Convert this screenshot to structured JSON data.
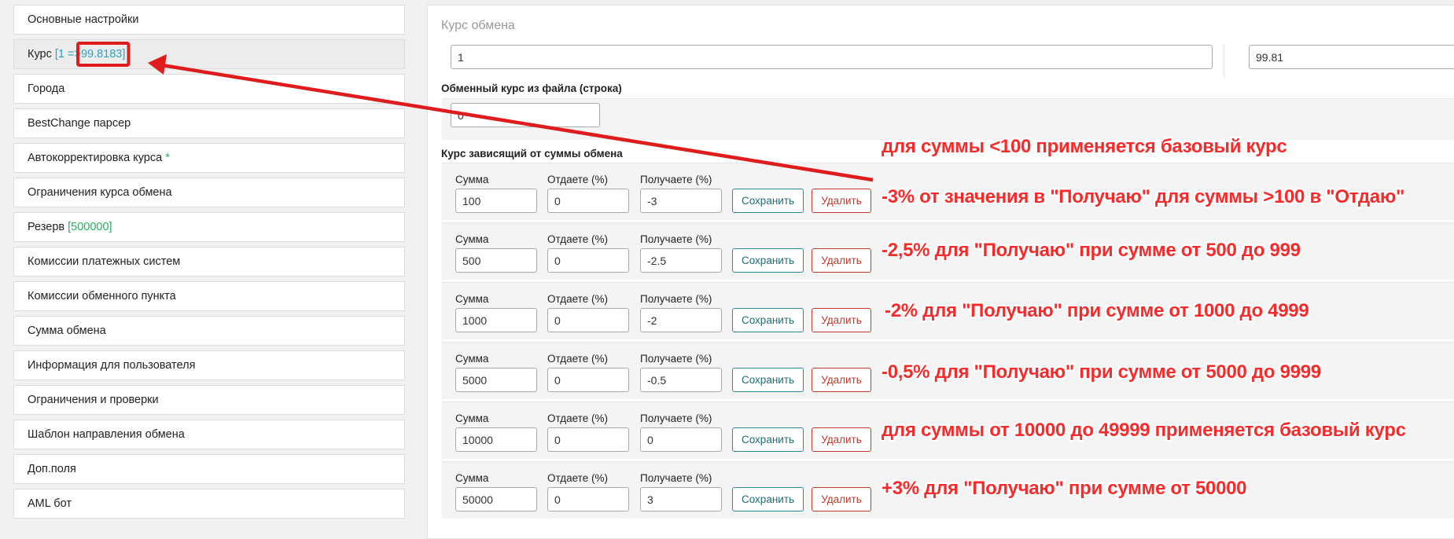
{
  "sidebar": {
    "items": [
      {
        "label": "Основные настройки"
      },
      {
        "label": "Курс",
        "suffix_open": "[1 =>",
        "suffix_value": "99.8183]"
      },
      {
        "label": "Города"
      },
      {
        "label": "BestChange парсер"
      },
      {
        "label": "Автокорректировка курса",
        "star": "*"
      },
      {
        "label": "Ограничения курса обмена"
      },
      {
        "label": "Резерв",
        "suffix": "[500000]"
      },
      {
        "label": "Комиссии платежных систем"
      },
      {
        "label": "Комиссии обменного пункта"
      },
      {
        "label": "Сумма обмена"
      },
      {
        "label": "Информация для пользователя"
      },
      {
        "label": "Ограничения и проверки"
      },
      {
        "label": "Шаблон направления обмена"
      },
      {
        "label": "Доп.поля"
      },
      {
        "label": "AML бот"
      }
    ]
  },
  "main": {
    "title": "Курс обмена",
    "rate_give": "1",
    "rate_get": "99.81",
    "file_rate_label": "Обменный курс из файла (строка)",
    "file_rate_value": "0",
    "dependent_label": "Курс зависящий от суммы обмена",
    "col_sum": "Сумма",
    "col_give": "Отдаете (%)",
    "col_get": "Получаете (%)",
    "save_label": "Сохранить",
    "delete_label": "Удалить",
    "rows": [
      {
        "sum": "100",
        "give": "0",
        "get": "-3"
      },
      {
        "sum": "500",
        "give": "0",
        "get": "-2.5"
      },
      {
        "sum": "1000",
        "give": "0",
        "get": "-2"
      },
      {
        "sum": "5000",
        "give": "0",
        "get": "-0.5"
      },
      {
        "sum": "10000",
        "give": "0",
        "get": "0"
      },
      {
        "sum": "50000",
        "give": "0",
        "get": "3"
      }
    ]
  },
  "annotations": {
    "note_0": "для суммы <100 применяется базовый курс",
    "note_1": "-3% от значения в \"Получаю\" для суммы >100 в \"Отдаю\"",
    "note_2": "-2,5% для \"Получаю\" при сумме от 500 до 999",
    "note_3": "-2% для \"Получаю\" при сумме от 1000 до 4999",
    "note_4": "-0,5% для \"Получаю\" при сумме от 5000 до 9999",
    "note_5": "для суммы от 10000 до 49999 применяется базовый курс",
    "note_6": "+3% для \"Получаю\" при сумме от 50000",
    "color": "#fb2a2a"
  }
}
